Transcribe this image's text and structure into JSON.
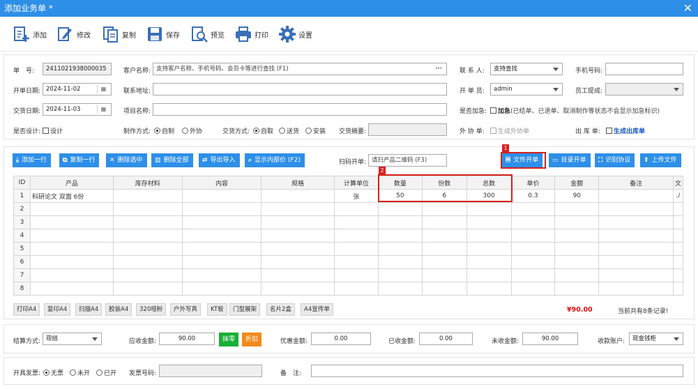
{
  "window": {
    "title": "添加业务单 *"
  },
  "toolbar": {
    "add": "添加",
    "edit": "修改",
    "copy": "复制",
    "save": "保存",
    "preview": "预览",
    "print": "打印",
    "settings": "设置"
  },
  "form": {
    "order_no_label": "单　号:",
    "order_no": "2411021938000035",
    "customer_label": "客户名称:",
    "customer_placeholder": "支持客户名称、手机号码、会员卡等进行查找 (F1)",
    "dots": "···",
    "contact_label": "联 系 人:",
    "contact_value": "支持查找",
    "phone_label": "手机号码:",
    "phone_value": "",
    "open_date_label": "开单日期:",
    "open_date": "2024-11-02",
    "address_label": "联系地址:",
    "address_value": "",
    "opener_label": "开 单 员:",
    "opener": "admin",
    "commission_label": "员工提成:",
    "commission_value": "",
    "delivery_date_label": "交货日期:",
    "delivery_date": "2024-11-03",
    "project_label": "项目名称:",
    "project_value": "",
    "urgent_label": "是否加急:",
    "urgent_option": "加急",
    "urgent_hint": "(已结单、已退单、取消制作等状态不会显示加急标识)",
    "design_label": "是否设计:",
    "design_option": "设计",
    "make_label": "制作方式:",
    "make_options": [
      "自制",
      "外协"
    ],
    "deliver_label": "交货方式:",
    "deliver_options": [
      "自取",
      "送货",
      "安装"
    ],
    "summary_label": "交货摘要:",
    "summary_value": "",
    "outsource_label": "外 协 单:",
    "outsource_option": "生成外协单",
    "outbound_label": "出 库 单:",
    "outbound_option": "生成出库单",
    "calendar_icon": "▦"
  },
  "actions": {
    "add_row": "添加一行",
    "copy_row": "复制一行",
    "delete_sel": "删除选中",
    "delete_all": "删除全部",
    "import_export": "导出导入",
    "show_internal": "显示内部价 (F2)",
    "scan_label": "扫码开单:",
    "scan_placeholder": "请扫产品二维码 (F3)",
    "file_order": "文件开单",
    "dir_order": "目录开单",
    "identify": "识别协议",
    "upload": "上传文件"
  },
  "badges": {
    "one": "1",
    "two": "2"
  },
  "table": {
    "headers": [
      "ID",
      "产品",
      "库存材料",
      "内容",
      "规格",
      "计算单位",
      "数量",
      "份数",
      "总数",
      "单价",
      "金额",
      "备注",
      "文"
    ],
    "rows": [
      [
        "1",
        "科研论文 双面 6份",
        "",
        "",
        "",
        "张",
        "50",
        "6",
        "300",
        "0.3",
        "90",
        "",
        "./"
      ],
      [
        "2",
        "",
        "",
        "",
        "",
        "",
        "",
        "",
        "",
        "",
        "",
        "",
        ""
      ],
      [
        "3",
        "",
        "",
        "",
        "",
        "",
        "",
        "",
        "",
        "",
        "",
        "",
        ""
      ],
      [
        "4",
        "",
        "",
        "",
        "",
        "",
        "",
        "",
        "",
        "",
        "",
        "",
        ""
      ],
      [
        "5",
        "",
        "",
        "",
        "",
        "",
        "",
        "",
        "",
        "",
        "",
        "",
        ""
      ],
      [
        "6",
        "",
        "",
        "",
        "",
        "",
        "",
        "",
        "",
        "",
        "",
        "",
        ""
      ],
      [
        "7",
        "",
        "",
        "",
        "",
        "",
        "",
        "",
        "",
        "",
        "",
        "",
        ""
      ],
      [
        "8",
        "",
        "",
        "",
        "",
        "",
        "",
        "",
        "",
        "",
        "",
        "",
        ""
      ]
    ]
  },
  "quick": [
    "打印A4",
    "复印A4",
    "扫描A4",
    "胶装A4",
    "320哑粉",
    "户外写真",
    "KT板",
    "门型展架",
    "名片2盒",
    "A4宣传单"
  ],
  "total": "¥90.00",
  "record_count": "当前共有8条记录!",
  "payment": {
    "method_label": "结算方式:",
    "method": "现结",
    "receivable_label": "应收金额:",
    "receivable": "90.00",
    "erase": "抹零",
    "discount": "折扣",
    "coupon_label": "优惠金额:",
    "coupon": "0.00",
    "received_label": "已收金额:",
    "received": "0.00",
    "unpaid_label": "未收金额:",
    "unpaid": "90.00",
    "account_label": "收款账户:",
    "account": "现金钱柜"
  },
  "invoice": {
    "label": "开具发票:",
    "options": [
      "无票",
      "未开",
      "已开"
    ],
    "no_label": "发票号码:",
    "no_value": "",
    "remark_label": "备　注:",
    "remark_value": ""
  },
  "colors": {
    "accent": "#2d8fe8",
    "highlight": "#d8201c",
    "green": "#18b035",
    "orange": "#f28a1a"
  }
}
